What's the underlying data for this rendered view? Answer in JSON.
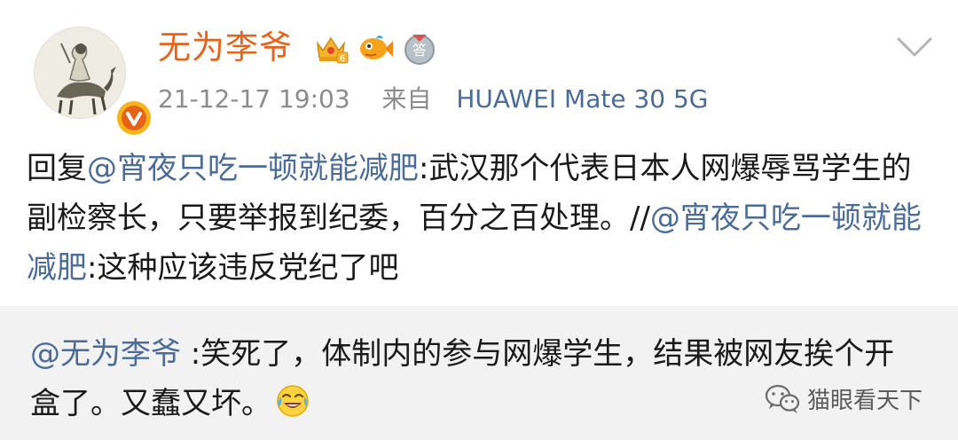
{
  "post": {
    "author": "无为李爷",
    "timestamp": "21-12-17 19:03",
    "source_prefix": "来自",
    "source_device": "HUAWEI Mate 30 5G",
    "badges": [
      "crown-badge-icon",
      "fish-badge-icon",
      "answer-badge-icon"
    ],
    "content": {
      "prefix": "回复",
      "mention1": "@宵夜只吃一顿就能减肥",
      "text1": ":武汉那个代表日本人网爆辱骂学生的副检察长，只要举报到纪委，百分之百处理。//",
      "mention2": "@宵夜只吃一顿就能减肥",
      "text2": ":这种应该违反党纪了吧"
    }
  },
  "reply": {
    "mention": "@无为李爷",
    "text": " :笑死了，体制内的参与网爆学生，结果被网友挨个开盒了。又蠢又坏。",
    "emoji": "laugh-cry-emoji"
  },
  "watermark": {
    "text": "猫眼看天下"
  },
  "colors": {
    "username": "#e8631a",
    "link": "#4b6c98",
    "meta": "#8c8c8c",
    "reply_bg": "#f2f2f2"
  }
}
